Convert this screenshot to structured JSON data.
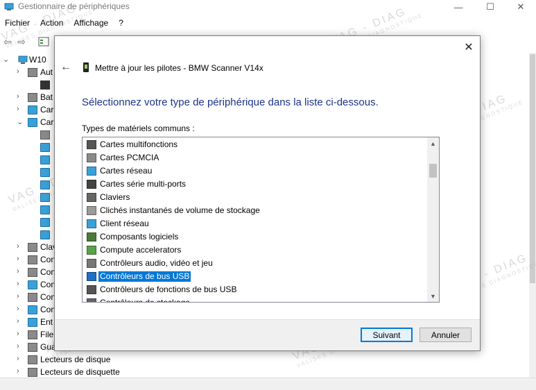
{
  "window": {
    "title": "Gestionnaire de périphériques",
    "controls": [
      "—",
      "☐",
      "✕"
    ]
  },
  "menu": [
    "Fichier",
    "Action",
    "Affichage",
    "?"
  ],
  "toolbar": {
    "back_glyph": "⇦",
    "forward_glyph": "⇨"
  },
  "tree": {
    "root": "W10",
    "items": [
      {
        "label": "Aut",
        "icon": "speaker-icon"
      },
      {
        "label": "",
        "icon": "warning-icon"
      },
      {
        "label": "Bat",
        "icon": "battery-icon"
      },
      {
        "label": "Car",
        "icon": "monitor-icon"
      },
      {
        "label": "Car",
        "icon": "monitor-icon"
      },
      {
        "label": "",
        "icon": "drive-icon"
      },
      {
        "label": "",
        "icon": "monitor-icon"
      },
      {
        "label": "",
        "icon": "monitor-icon"
      },
      {
        "label": "",
        "icon": "monitor-icon"
      },
      {
        "label": "",
        "icon": "monitor-icon"
      },
      {
        "label": "",
        "icon": "monitor-icon"
      },
      {
        "label": "",
        "icon": "monitor-icon"
      },
      {
        "label": "",
        "icon": "monitor-icon"
      },
      {
        "label": "",
        "icon": "monitor-icon"
      },
      {
        "label": "Clav",
        "icon": "keyboard-icon"
      },
      {
        "label": "Con",
        "icon": "speaker-icon"
      },
      {
        "label": "Con",
        "icon": "speaker-icon"
      },
      {
        "label": "Con",
        "icon": "monitor-icon"
      },
      {
        "label": "Con",
        "icon": "network-icon"
      },
      {
        "label": "Con",
        "icon": "monitor-icon"
      },
      {
        "label": "Ent",
        "icon": "monitor-icon"
      },
      {
        "label": "File",
        "icon": "queue-icon"
      },
      {
        "label": "Gua",
        "icon": "shield-icon"
      },
      {
        "label": "Lecteurs de disque",
        "icon": "disk-icon"
      },
      {
        "label": "Lecteurs de disquette",
        "icon": "floppy-icon"
      }
    ]
  },
  "dialog": {
    "title": "Mettre à jour les pilotes - BMW Scanner V14x",
    "heading": "Sélectionnez votre type de périphérique dans la liste ci-dessous.",
    "list_label": "Types de matériels communs :",
    "items": [
      {
        "label": "Cartes multifonctions",
        "icon": "multifunction-card-icon",
        "color": "#555555"
      },
      {
        "label": "Cartes PCMCIA",
        "icon": "pcmcia-card-icon",
        "color": "#8a8a8a"
      },
      {
        "label": "Cartes réseau",
        "icon": "network-card-icon",
        "color": "#3aa1d8"
      },
      {
        "label": "Cartes série multi-ports",
        "icon": "serial-port-icon",
        "color": "#444444"
      },
      {
        "label": "Claviers",
        "icon": "keyboard-icon",
        "color": "#666666"
      },
      {
        "label": "Clichés instantanés de volume de stockage",
        "icon": "storage-snapshot-icon",
        "color": "#9a9a9a"
      },
      {
        "label": "Client réseau",
        "icon": "network-client-icon",
        "color": "#3aa1d8"
      },
      {
        "label": "Composants logiciels",
        "icon": "software-component-icon",
        "color": "#4a7a3a"
      },
      {
        "label": "Compute accelerators",
        "icon": "chip-icon",
        "color": "#5aa14a"
      },
      {
        "label": "Contrôleurs audio, vidéo et jeu",
        "icon": "speaker-icon",
        "color": "#777777"
      },
      {
        "label": "Contrôleurs de bus USB",
        "icon": "usb-icon",
        "color": "#1f6fc4",
        "selected": true
      },
      {
        "label": "Contrôleurs de fonctions de bus USB",
        "icon": "usb-icon",
        "color": "#555555"
      },
      {
        "label": "Contrôleurs de stockage",
        "icon": "storage-controller-icon",
        "color": "#666666"
      }
    ],
    "buttons": {
      "next": "Suivant",
      "cancel": "Annuler"
    }
  },
  "watermark": {
    "main": "VAG - DIAG",
    "sub": "VALISES DIAGNOSTIQUE"
  },
  "colors": {
    "heading": "#1e3287",
    "selection": "#0078d7"
  }
}
